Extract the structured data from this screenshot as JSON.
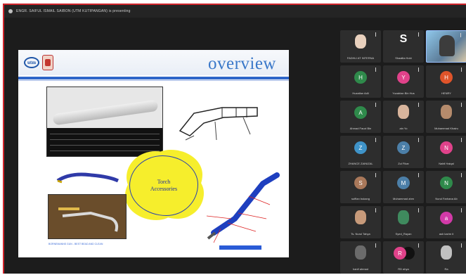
{
  "presenter_bar": {
    "text": "ENGR. SAIFUL ISMAIL SAIBON (UTM KUTIPANGAN) is presenting"
  },
  "slide": {
    "title": "overview",
    "logo_text": "utm",
    "cloud_text": [
      "Torch",
      "Accessories"
    ],
    "photo2_caption": "BORNEMANNS GUN - BEST BEAD AND CLEAN"
  },
  "participants": [
    {
      "name": "FADHLI AT INTERNA",
      "initial": "",
      "color": "#e8d0bd",
      "kind": "photo"
    },
    {
      "name": "Shaalila Hobi",
      "initial": "S",
      "color": "#2d2d2d",
      "kind": "letter"
    },
    {
      "name": "",
      "initial": "",
      "color": "#7ab7e0",
      "kind": "video"
    },
    {
      "name": "Huzaifan Adli",
      "initial": "H",
      "color": "#2f8a4b",
      "kind": "avatar"
    },
    {
      "name": "Yuzairian Bin Hus",
      "initial": "Y",
      "color": "#e0428a",
      "kind": "avatar"
    },
    {
      "name": "HENRY",
      "initial": "H",
      "color": "#e0542a",
      "kind": "avatar"
    },
    {
      "name": "Ahmad Fauzi Bin",
      "initial": "A",
      "color": "#2f8a4b",
      "kind": "avatar"
    },
    {
      "name": "ain Yo",
      "initial": "",
      "color": "#d8b49c",
      "kind": "photo"
    },
    {
      "name": "Muhammad Khairu",
      "initial": "",
      "color": "#b58b6c",
      "kind": "photo"
    },
    {
      "name": "ZHANCE ZAINIZAL",
      "initial": "Z",
      "color": "#3f93c8",
      "kind": "avatar"
    },
    {
      "name": "Zul Fikar",
      "initial": "Z",
      "color": "#4c7fa8",
      "kind": "avatar"
    },
    {
      "name": "Nabil Haiqal",
      "initial": "N",
      "color": "#e0428a",
      "kind": "avatar"
    },
    {
      "name": "suffian bukang",
      "initial": "S",
      "color": "#a9785a",
      "kind": "avatar"
    },
    {
      "name": "Muhammad ahm",
      "initial": "M",
      "color": "#4c7fa8",
      "kind": "avatar"
    },
    {
      "name": "Nurul Farhana Ab",
      "initial": "N",
      "color": "#2f8a4b",
      "kind": "avatar"
    },
    {
      "name": "Ts. Nurul Tahya",
      "initial": "",
      "color": "#c79a7a",
      "kind": "photo"
    },
    {
      "name": "Syed_Rayan",
      "initial": "",
      "color": "#3f8a5e",
      "kind": "photo"
    },
    {
      "name": "ash karim it",
      "initial": "a",
      "color": "#d23aa8",
      "kind": "avatar"
    },
    {
      "name": "hanif ahmad",
      "initial": "",
      "color": "#6b6b6b",
      "kind": "photo"
    },
    {
      "name": "RD ahya",
      "initial": "R",
      "color": "#e0428a",
      "kind": "dual"
    },
    {
      "name": "Ra",
      "initial": "",
      "color": "#c0c0c0",
      "kind": "photo"
    }
  ]
}
